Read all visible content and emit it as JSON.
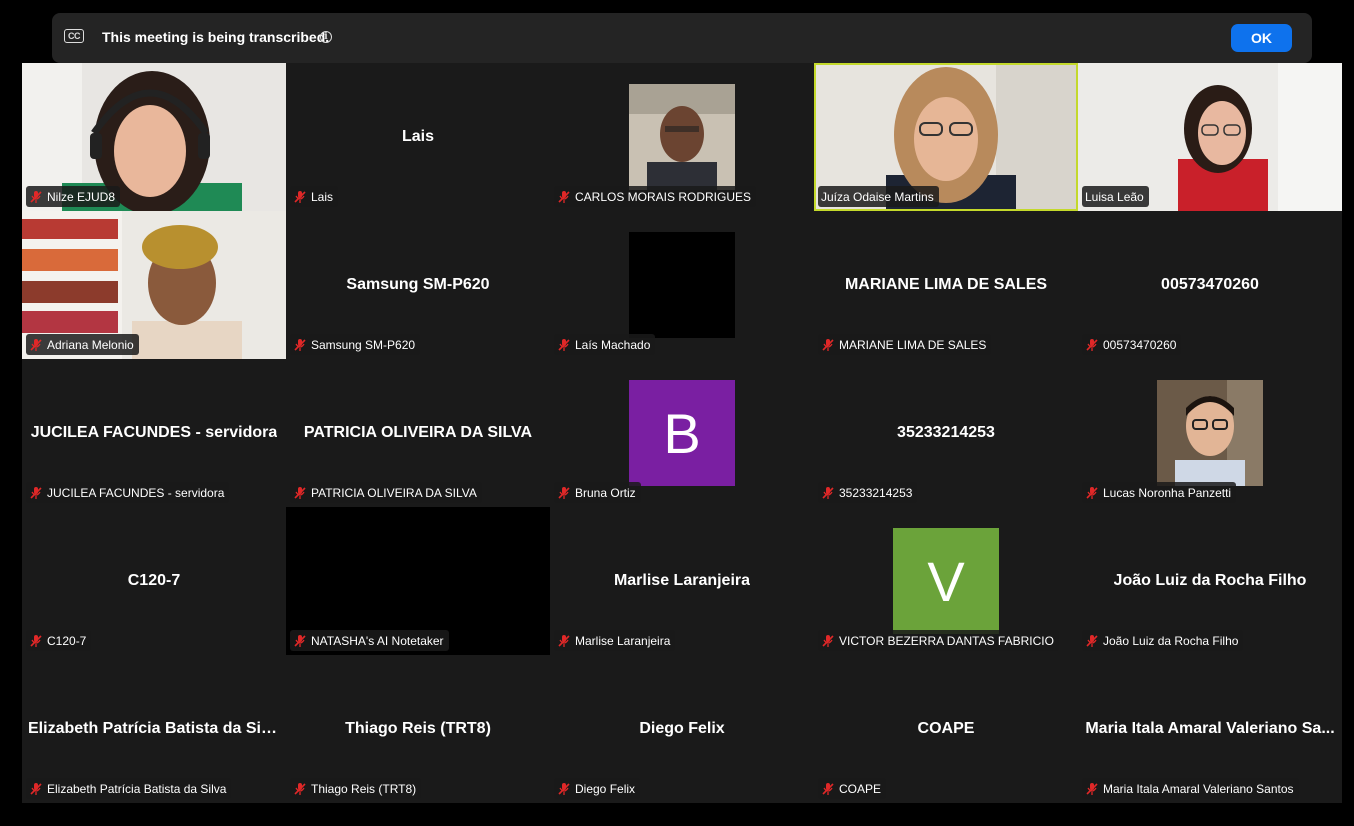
{
  "banner": {
    "cc_icon": "CC",
    "text": "This meeting is being transcribed.",
    "info_icon": "i",
    "ok_label": "OK"
  },
  "colors": {
    "ok_button": "#0e72ed",
    "active_speaker_border": "#c4d92b",
    "muted_icon": "#e02828",
    "avatar_b": "#7a1fa2",
    "avatar_v": "#6ba33a"
  },
  "participants": [
    {
      "label": "Nilze EJUD8"
    },
    {
      "label": "Lais",
      "center": "Lais"
    },
    {
      "label": "CARLOS MORAIS RODRIGUES"
    },
    {
      "label": "Juíza Odaise Martins"
    },
    {
      "label": "Luisa Leão"
    },
    {
      "label": "Adriana Melonio"
    },
    {
      "label": "Samsung SM-P620",
      "center": "Samsung SM-P620"
    },
    {
      "label": "Laís Machado"
    },
    {
      "label": "MARIANE LIMA DE SALES",
      "center": "MARIANE LIMA DE SALES"
    },
    {
      "label": "00573470260",
      "center": "00573470260"
    },
    {
      "label": "JUCILEA FACUNDES - servidora",
      "center": "JUCILEA FACUNDES - servidora"
    },
    {
      "label": "PATRICIA OLIVEIRA DA SILVA",
      "center": "PATRICIA OLIVEIRA DA SILVA"
    },
    {
      "label": "Bruna Ortiz",
      "avatar": "B"
    },
    {
      "label": "35233214253",
      "center": "35233214253"
    },
    {
      "label": "Lucas Noronha Panzetti"
    },
    {
      "label": "C120-7",
      "center": "C120-7"
    },
    {
      "label": "NATASHA's AI Notetaker"
    },
    {
      "label": "Marlise Laranjeira",
      "center": "Marlise Laranjeira"
    },
    {
      "label": "VICTOR BEZERRA DANTAS FABRICIO",
      "avatar": "V"
    },
    {
      "label": "João Luiz da Rocha Filho",
      "center": "João Luiz da Rocha Filho"
    },
    {
      "label": "Elizabeth Patrícia Batista da Silva",
      "center": "Elizabeth Patrícia Batista da Silva"
    },
    {
      "label": "Thiago Reis (TRT8)",
      "center": "Thiago Reis (TRT8)"
    },
    {
      "label": "Diego Felix",
      "center": "Diego Felix"
    },
    {
      "label": "COAPE",
      "center": "COAPE"
    },
    {
      "label": "Maria Itala Amaral Valeriano Santos",
      "center": "Maria Itala Amaral Valeriano Sa..."
    }
  ]
}
